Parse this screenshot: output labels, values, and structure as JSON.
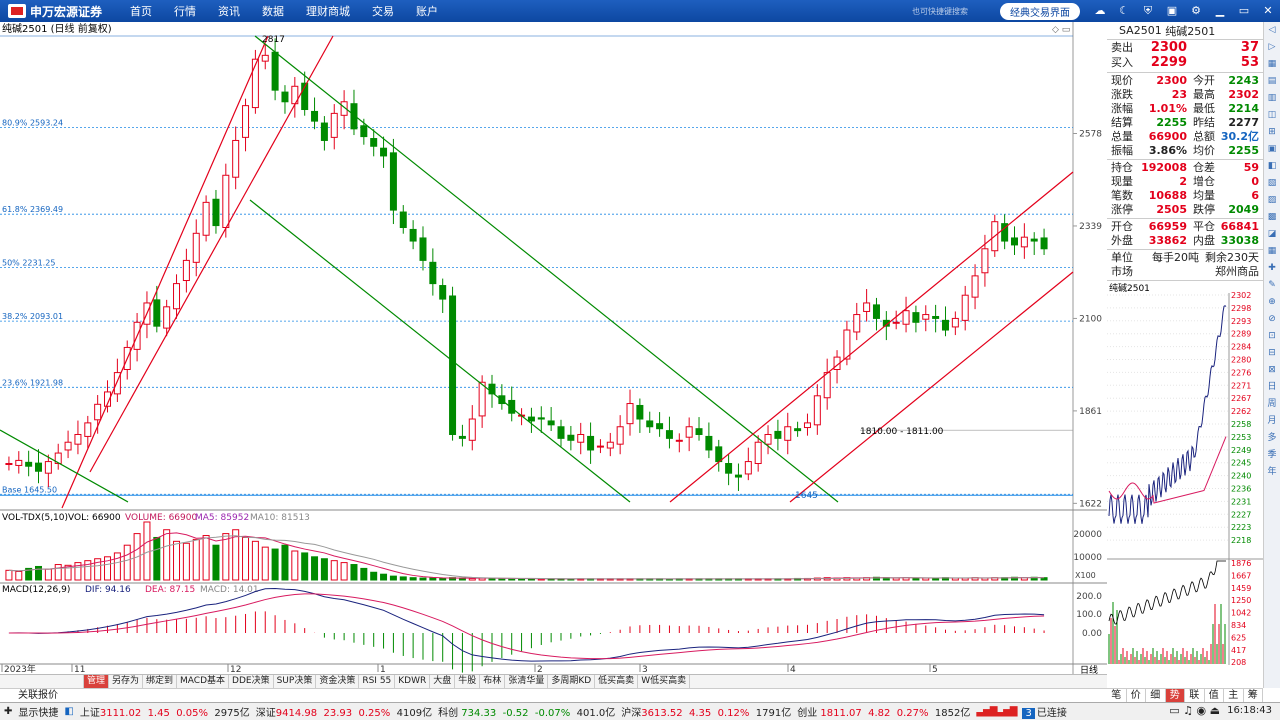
{
  "app": {
    "logo_text": "申万宏源证券",
    "logo_sub": "SHENWAN HONGYUAN SECURITIES"
  },
  "menu": [
    "首页",
    "行情",
    "资讯",
    "数据",
    "理财商城",
    "交易",
    "账户"
  ],
  "topbar": {
    "hint": "也可快捷键搜索",
    "classic_button": "经典交易界面",
    "icons": [
      "cloud-icon",
      "moon-icon",
      "shield-icon",
      "save-icon",
      "gear-icon",
      "minimize-icon",
      "restore-icon",
      "close-icon"
    ]
  },
  "chart_title": "纯碱2501 (日线 前复权)",
  "chart_data": {
    "type": "candlestick",
    "title": "纯碱2501 (日线 前复权)",
    "y_ticks": [
      2578,
      2339,
      2100,
      1861,
      1622
    ],
    "ylim": [
      1610,
      2830
    ],
    "x_ticks": [
      "2023年",
      "11",
      "12",
      "1",
      "2",
      "3",
      "4",
      "5"
    ],
    "fib_levels": [
      {
        "label": "80.9% 2593.24",
        "value": 2593.24
      },
      {
        "label": "61.8% 2369.49",
        "value": 2369.49
      },
      {
        "label": "50% 2231.25",
        "value": 2231.25
      },
      {
        "label": "38.2% 2093.01",
        "value": 2093.01
      },
      {
        "label": "23.6% 1921.98",
        "value": 1921.98
      },
      {
        "label": "Base 1645.50",
        "value": 1645.5
      }
    ],
    "annotations": {
      "high": "2817",
      "low": "1645",
      "range": "1810.00 - 1811.00"
    },
    "closes": [
      1725,
      1733,
      1718,
      1705,
      1730,
      1752,
      1780,
      1800,
      1830,
      1878,
      1910,
      1960,
      2025,
      2090,
      2140,
      2080,
      2130,
      2190,
      2250,
      2320,
      2400,
      2340,
      2470,
      2560,
      2650,
      2770,
      2780,
      2690,
      2660,
      2700,
      2640,
      2610,
      2560,
      2630,
      2660,
      2590,
      2570,
      2545,
      2520,
      2380,
      2335,
      2300,
      2250,
      2190,
      2150,
      1800,
      1790,
      1840,
      1935,
      1905,
      1880,
      1855,
      1850,
      1835,
      1840,
      1825,
      1790,
      1785,
      1800,
      1760,
      1770,
      1780,
      1820,
      1880,
      1840,
      1820,
      1815,
      1790,
      1785,
      1820,
      1800,
      1760,
      1730,
      1700,
      1690,
      1730,
      1780,
      1800,
      1790,
      1820,
      1810,
      1830,
      1900,
      1960,
      2000,
      2070,
      2110,
      2140,
      2100,
      2080,
      2090,
      2120,
      2090,
      2110,
      2100,
      2070,
      2100,
      2160,
      2210,
      2280,
      2350,
      2300,
      2290,
      2310,
      2300,
      2280
    ]
  },
  "volume_indicator": {
    "name": "VOL-TDX(5,10)",
    "vol": "VOL: 66900",
    "volume": "VOLUME: 66900",
    "ma5": "MA5: 85952",
    "ma10": "MA10: 81513",
    "y_ticks": [
      "20000",
      "10000"
    ],
    "scale": "X100",
    "values": [
      25,
      22,
      30,
      35,
      28,
      40,
      38,
      45,
      50,
      55,
      60,
      70,
      90,
      120,
      150,
      110,
      130,
      100,
      95,
      105,
      115,
      90,
      120,
      130,
      110,
      100,
      85,
      80,
      90,
      75,
      70,
      60,
      55,
      50,
      45,
      40,
      30,
      20,
      15,
      10,
      8,
      6,
      5,
      5,
      4,
      6,
      5,
      4,
      5,
      4,
      3,
      4,
      3,
      3,
      3,
      3,
      3,
      2,
      3,
      3,
      3,
      3,
      3,
      3,
      3,
      3,
      3,
      2,
      3,
      3,
      3,
      3,
      3,
      3,
      3,
      3,
      3,
      3,
      3,
      3,
      4,
      4,
      5,
      6,
      5,
      6,
      5,
      6,
      7,
      6,
      5,
      6,
      5,
      5,
      5,
      6,
      5,
      5,
      6,
      5,
      6,
      6,
      7,
      6,
      7,
      6
    ]
  },
  "macd_indicator": {
    "name": "MACD(12,26,9)",
    "dif": "DIF: 94.16",
    "dea": "DEA: 87.15",
    "macd": "MACD: 14.01",
    "y_ticks": [
      "200.0",
      "100.0",
      "0.00"
    ]
  },
  "x_axis_label": "日线",
  "tabs": [
    "管理",
    "另存为",
    "绑定到",
    "MACD基本",
    "DDE决策",
    "SUP决策",
    "资金决策",
    "RSI 55",
    "KDWR",
    "大盘",
    "牛股",
    "布林",
    "张清华量",
    "多周期KD",
    "低买高卖",
    "W低买高卖"
  ],
  "related": "关联报价",
  "quote": {
    "code": "SA2501",
    "name": "纯碱2501",
    "sell_label": "卖出",
    "sell_price": "2300",
    "sell_vol": "37",
    "buy_label": "买入",
    "buy_price": "2299",
    "buy_vol": "53",
    "rows1": [
      {
        "l": "现价",
        "v": "2300",
        "vc": "red",
        "l2": "今开",
        "v2": "2243",
        "v2c": "green"
      },
      {
        "l": "涨跌",
        "v": "23",
        "vc": "red",
        "l2": "最高",
        "v2": "2302",
        "v2c": "red"
      },
      {
        "l": "涨幅",
        "v": "1.01%",
        "vc": "red",
        "l2": "最低",
        "v2": "2214",
        "v2c": "green"
      },
      {
        "l": "结算",
        "v": "2255",
        "vc": "green",
        "l2": "昨结",
        "v2": "2277",
        "v2c": ""
      },
      {
        "l": "总量",
        "v": "66900",
        "vc": "red",
        "l2": "总额",
        "v2": "30.2亿",
        "v2c": "blue"
      },
      {
        "l": "振幅",
        "v": "3.86%",
        "vc": "",
        "l2": "均价",
        "v2": "2255",
        "v2c": "green"
      }
    ],
    "rows2": [
      {
        "l": "持仓",
        "v": "192008",
        "vc": "red",
        "l2": "仓差",
        "v2": "59",
        "v2c": "red"
      },
      {
        "l": "现量",
        "v": "2",
        "vc": "red",
        "l2": "增仓",
        "v2": "0",
        "v2c": "red"
      },
      {
        "l": "笔数",
        "v": "10688",
        "vc": "red",
        "l2": "均量",
        "v2": "6",
        "v2c": "red"
      },
      {
        "l": "涨停",
        "v": "2505",
        "vc": "red",
        "l2": "跌停",
        "v2": "2049",
        "v2c": "green"
      }
    ],
    "rows3": [
      {
        "l": "开仓",
        "v": "66959",
        "vc": "red",
        "l2": "平仓",
        "v2": "66841",
        "v2c": "red"
      },
      {
        "l": "外盘",
        "v": "33862",
        "vc": "red",
        "l2": "内盘",
        "v2": "33038",
        "v2c": "green"
      }
    ],
    "unit_label": "单位",
    "unit_value": "每手20吨",
    "remain": "剩余230天",
    "market_label": "市场",
    "market_value": "郑州商品",
    "mini_title": "纯碱2501",
    "mini_ticks": [
      "2302",
      "2298",
      "2293",
      "2289",
      "2284",
      "2280",
      "2276",
      "2271",
      "2267",
      "2262",
      "2258",
      "2253",
      "2249",
      "2245",
      "2240",
      "2236",
      "2231",
      "2227",
      "2223",
      "2218"
    ],
    "mini_vol_ticks": [
      "1876",
      "1667",
      "1459",
      "1250",
      "1042",
      "834",
      "625",
      "417",
      "208"
    ]
  },
  "rp_bottom_tabs": [
    "笔",
    "价",
    "细",
    "势",
    "联",
    "值",
    "主",
    "筹"
  ],
  "scroll_icons": [
    "◁",
    "▷",
    "▦",
    "▤",
    "▥",
    "◫",
    "⊞",
    "▣",
    "◧",
    "▧",
    "▨",
    "▩",
    "◪",
    "▦",
    "✚",
    "✎",
    "⊕",
    "⊘",
    "⊡",
    "⊟",
    "⊠",
    "日",
    "周",
    "月",
    "多",
    "季",
    "年"
  ],
  "statusbar": {
    "show_label": "显示快捷",
    "shanghai": {
      "name": "上证",
      "price": "3111.02",
      "chg": "1.45",
      "pct": "0.05%",
      "amt": "2975亿"
    },
    "shenzhen": {
      "name": "深证",
      "price": "9414.98",
      "chg": "23.93",
      "pct": "0.25%",
      "amt": "4109亿"
    },
    "kechuang": {
      "name": "科创",
      "price": "734.33",
      "chg": "-0.52",
      "pct": "-0.07%",
      "amt": "401.0亿"
    },
    "hushen": {
      "name": "沪深",
      "price": "3613.52",
      "chg": "4.35",
      "pct": "0.12%",
      "amt": "1791亿"
    },
    "chuangye": {
      "name": "创业",
      "price": "1811.07",
      "chg": "4.82",
      "pct": "0.27%",
      "amt": "1852亿"
    },
    "conn_num": "3",
    "conn_text": "已连接",
    "time": "16:18:43"
  }
}
